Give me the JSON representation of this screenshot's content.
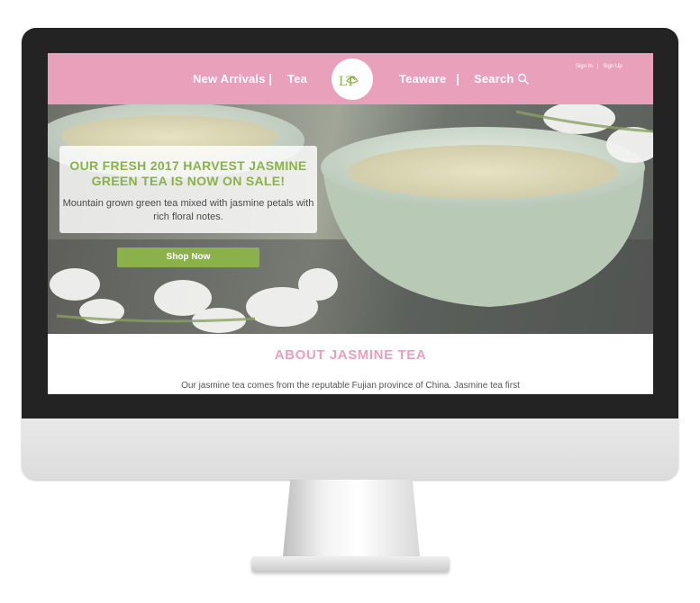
{
  "nav": {
    "links": [
      "New Arrivals",
      "Tea",
      "Teaware",
      "Search"
    ],
    "separator": "|",
    "logo_text": "LT",
    "account": {
      "sign_in": "Sign In",
      "separator": "|",
      "sign_up": "Sign Up"
    }
  },
  "hero": {
    "headline": "OUR FRESH 2017 HARVEST JASMINE GREEN TEA IS NOW ON SALE!",
    "description": "Mountain grown green tea mixed with jasmine petals with rich floral notes.",
    "cta_label": "Shop Now"
  },
  "about": {
    "title": "ABOUT JASMINE TEA",
    "text": "Our jasmine tea comes from the reputable Fujian province of China. Jasmine tea first"
  },
  "colors": {
    "nav_background": "#e9a0bb",
    "accent_green": "#8bb14a",
    "about_title": "#e9a0bb",
    "bezel": "#232323"
  },
  "icons": [
    "search-icon",
    "lotus-icon"
  ]
}
